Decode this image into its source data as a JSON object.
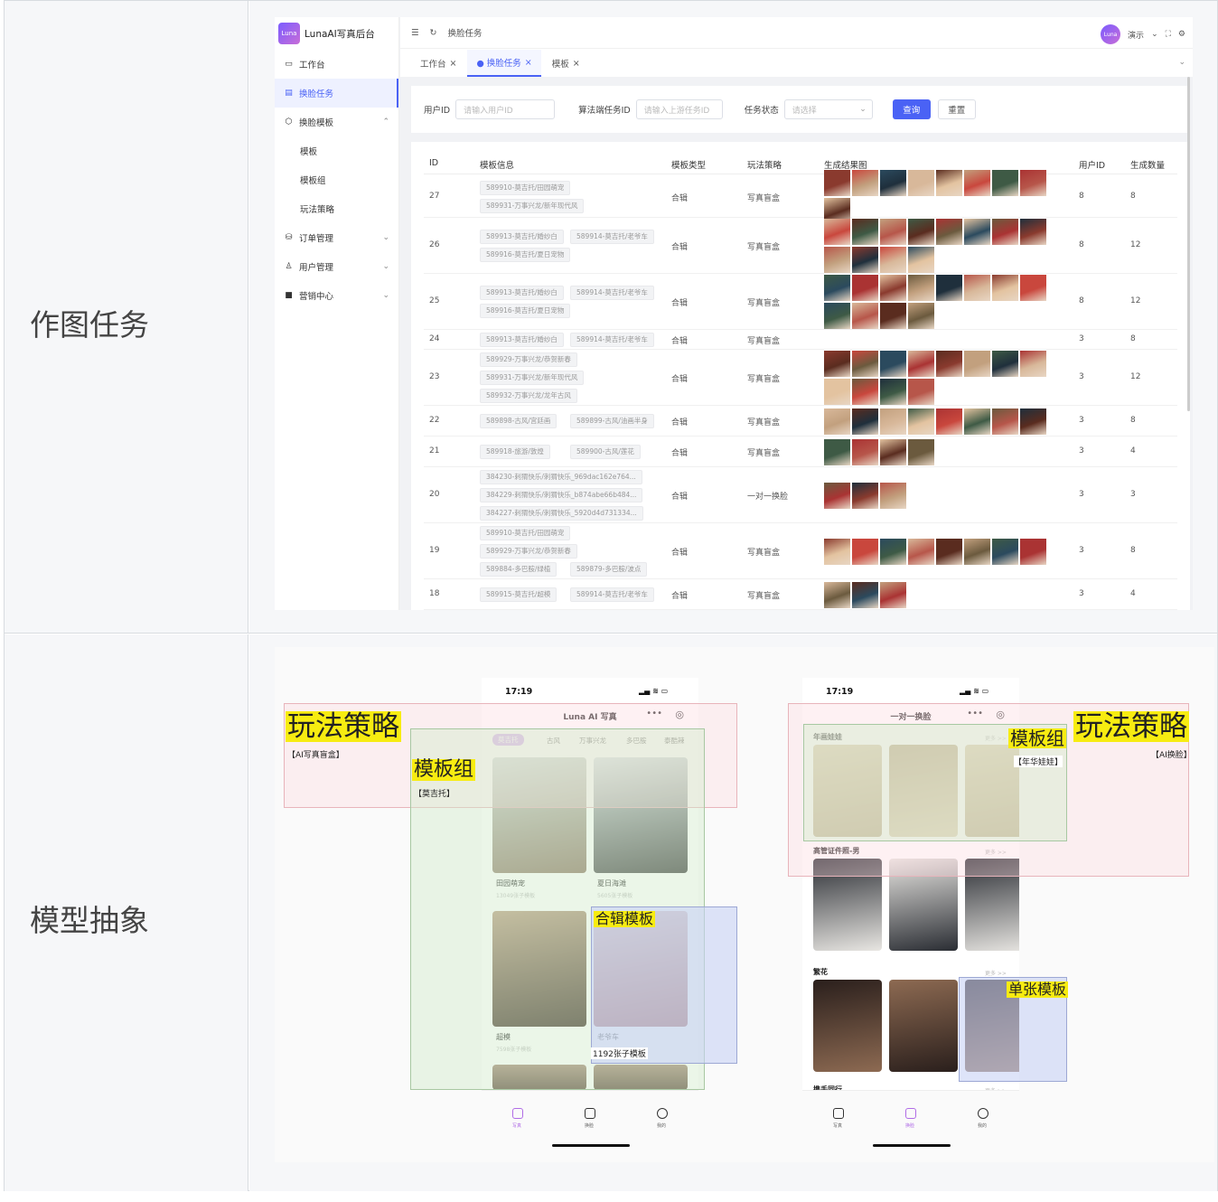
{
  "rows": [
    {
      "label": "作图任务"
    },
    {
      "label": "模型抽象"
    }
  ],
  "admin": {
    "logo_badge": "Luna",
    "app_title": "LunaAI写真后台",
    "sidebar": [
      {
        "label": "工作台",
        "icon": "monitor-icon"
      },
      {
        "label": "换脸任务",
        "icon": "task-icon"
      },
      {
        "label": "换脸模板",
        "icon": "template-icon"
      },
      {
        "label": "模板"
      },
      {
        "label": "模板组"
      },
      {
        "label": "玩法策略"
      },
      {
        "label": "订单管理",
        "icon": "database-icon"
      },
      {
        "label": "用户管理",
        "icon": "user-icon"
      },
      {
        "label": "营销中心",
        "icon": "bag-icon"
      }
    ],
    "breadcrumb": "换脸任务",
    "user_name": "演示",
    "avatar_text": "Luna",
    "tabs": [
      {
        "label": "工作台"
      },
      {
        "label": "● 换脸任务"
      },
      {
        "label": "模板"
      }
    ],
    "filter": {
      "user_id_label": "用户ID",
      "user_id_placeholder": "请输入用户ID",
      "task_id_label": "算法端任务ID",
      "task_id_placeholder": "请输入上游任务ID",
      "status_label": "任务状态",
      "status_placeholder": "请选择",
      "search_label": "查询",
      "reset_label": "重置"
    },
    "columns": [
      "ID",
      "模板信息",
      "模板类型",
      "玩法策略",
      "生成结果图",
      "用户ID",
      "生成数量"
    ],
    "rows": [
      {
        "id": "27",
        "tags": [
          "589910-莫吉托/田园萌宠",
          "589931-万事兴龙/新年现代风"
        ],
        "type": "合辑",
        "strategy": "写真盲盒",
        "images": 9,
        "uid": "8",
        "count": "8"
      },
      {
        "id": "26",
        "tags": [
          "589913-莫吉托/婚纱白",
          "589914-莫吉托/老爷车",
          "589916-莫吉托/夏日宠物"
        ],
        "type": "合辑",
        "strategy": "写真盲盒",
        "images": 12,
        "uid": "8",
        "count": "12"
      },
      {
        "id": "25",
        "tags": [
          "589913-莫吉托/婚纱白",
          "589914-莫吉托/老爷车",
          "589916-莫吉托/夏日宠物"
        ],
        "type": "合辑",
        "strategy": "写真盲盒",
        "images": 12,
        "uid": "8",
        "count": "12"
      },
      {
        "id": "24",
        "tags": [
          "589913-莫吉托/婚纱白",
          "589914-莫吉托/老爷车"
        ],
        "type": "合辑",
        "strategy": "写真盲盒",
        "images": 0,
        "uid": "3",
        "count": "8"
      },
      {
        "id": "23",
        "tags": [
          "589929-万事兴龙/恭贺新春",
          "589931-万事兴龙/新年现代风",
          "589932-万事兴龙/龙年古风"
        ],
        "type": "合辑",
        "strategy": "写真盲盒",
        "images": 12,
        "uid": "3",
        "count": "12"
      },
      {
        "id": "22",
        "tags": [
          "589898-古风/宫廷画",
          "589899-古风/油画半身"
        ],
        "type": "合辑",
        "strategy": "写真盲盒",
        "images": 8,
        "uid": "3",
        "count": "8"
      },
      {
        "id": "21",
        "tags": [
          "589918-旅游/敦煌",
          "589900-古风/莲花"
        ],
        "type": "合辑",
        "strategy": "写真盲盒",
        "images": 4,
        "uid": "3",
        "count": "4"
      },
      {
        "id": "20",
        "tags": [
          "384230-刺猬快乐/刺猬快乐_969dac162e764...",
          "384229-刺猬快乐/刺猬快乐_b874abe66b484...",
          "384227-刺猬快乐/刺猬快乐_5920d4d731334..."
        ],
        "type": "合辑",
        "strategy": "一对一换脸",
        "images": 3,
        "uid": "3",
        "count": "3"
      },
      {
        "id": "19",
        "tags": [
          "589910-莫吉托/田园萌宠",
          "589929-万事兴龙/恭贺新春",
          "589884-多巴胺/绿植",
          "589879-多巴胺/波点"
        ],
        "type": "合辑",
        "strategy": "写真盲盒",
        "images": 8,
        "uid": "3",
        "count": "8"
      },
      {
        "id": "18",
        "tags": [
          "589915-莫吉托/超模",
          "589914-莫吉托/老爷车"
        ],
        "type": "合辑",
        "strategy": "写真盲盒",
        "images": 3,
        "uid": "3",
        "count": "4"
      }
    ]
  },
  "phone_left": {
    "time": "17:19",
    "title": "Luna AI 写真",
    "tabs": [
      "莫吉托",
      "古风",
      "万事兴龙",
      "多巴胺",
      "泰酷辣"
    ],
    "cards": [
      {
        "title": "田园萌宠",
        "sub": "13049张子模板"
      },
      {
        "title": "夏日海滩",
        "sub": "5605张子模板"
      },
      {
        "title": "超模",
        "sub": "7598张子模板"
      },
      {
        "title": "老爷车",
        "sub": ""
      }
    ],
    "nav": [
      "写真",
      "换脸",
      "我的"
    ],
    "hl_strategy": "玩法策略",
    "hl_strategy_sub": "【AI写真盲盒】",
    "hl_group": "模板组",
    "hl_group_sub": "【莫吉托】",
    "hl_collection": "合辑模板",
    "hl_collection_sub": "1192张子模板"
  },
  "phone_right": {
    "time": "17:19",
    "title": "一对一换脸",
    "sections": [
      {
        "title": "年画娃娃",
        "more": "更多 >>"
      },
      {
        "title": "高管证件照-男",
        "more": "更多 >>"
      },
      {
        "title": "繁花",
        "more": "更多 >>"
      },
      {
        "title": "携手同行",
        "more": "更多 >>"
      }
    ],
    "nav": [
      "写真",
      "换脸",
      "我的"
    ],
    "hl_strategy": "玩法策略",
    "hl_strategy_sub": "【AI换脸】",
    "hl_group": "模板组",
    "hl_group_sub": "【年华娃娃】",
    "hl_single": "单张模板"
  },
  "colors": {
    "accent": "#4a62f5",
    "highlight": "#f7ec11"
  }
}
